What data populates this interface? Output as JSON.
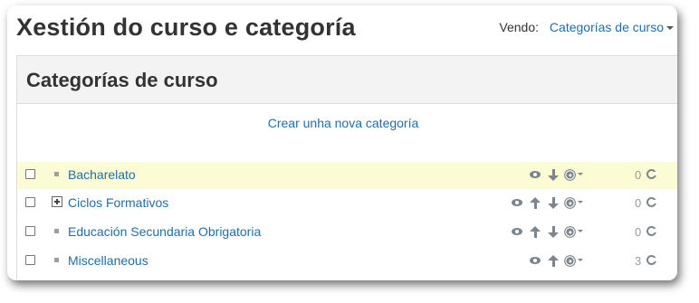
{
  "page": {
    "title": "Xestión do curso e categoría",
    "viewing_label": "Vendo:",
    "viewing_value": "Categorías de curso"
  },
  "panel": {
    "title": "Categorías de curso",
    "create_link": "Crear unha nova categoría"
  },
  "categories": [
    {
      "name": "Bacharelato",
      "count": "0",
      "highlighted": true,
      "expandable": false,
      "actions": [
        "eye-icon",
        "arrow-down-icon",
        "gear-icon"
      ]
    },
    {
      "name": "Ciclos Formativos",
      "count": "0",
      "highlighted": false,
      "expandable": true,
      "actions": [
        "eye-icon",
        "arrow-up-icon",
        "arrow-down-icon",
        "gear-icon"
      ]
    },
    {
      "name": "Educación Secundaria Obrigatoria",
      "count": "0",
      "highlighted": false,
      "expandable": false,
      "actions": [
        "eye-icon",
        "arrow-up-icon",
        "arrow-down-icon",
        "gear-icon"
      ]
    },
    {
      "name": "Miscellaneous",
      "count": "3",
      "highlighted": false,
      "expandable": false,
      "actions": [
        "eye-icon",
        "arrow-up-icon",
        "gear-icon"
      ]
    }
  ],
  "colors": {
    "link": "#1f6fa4",
    "highlight_row": "#fcfcd4",
    "icon": "#7d858c"
  }
}
